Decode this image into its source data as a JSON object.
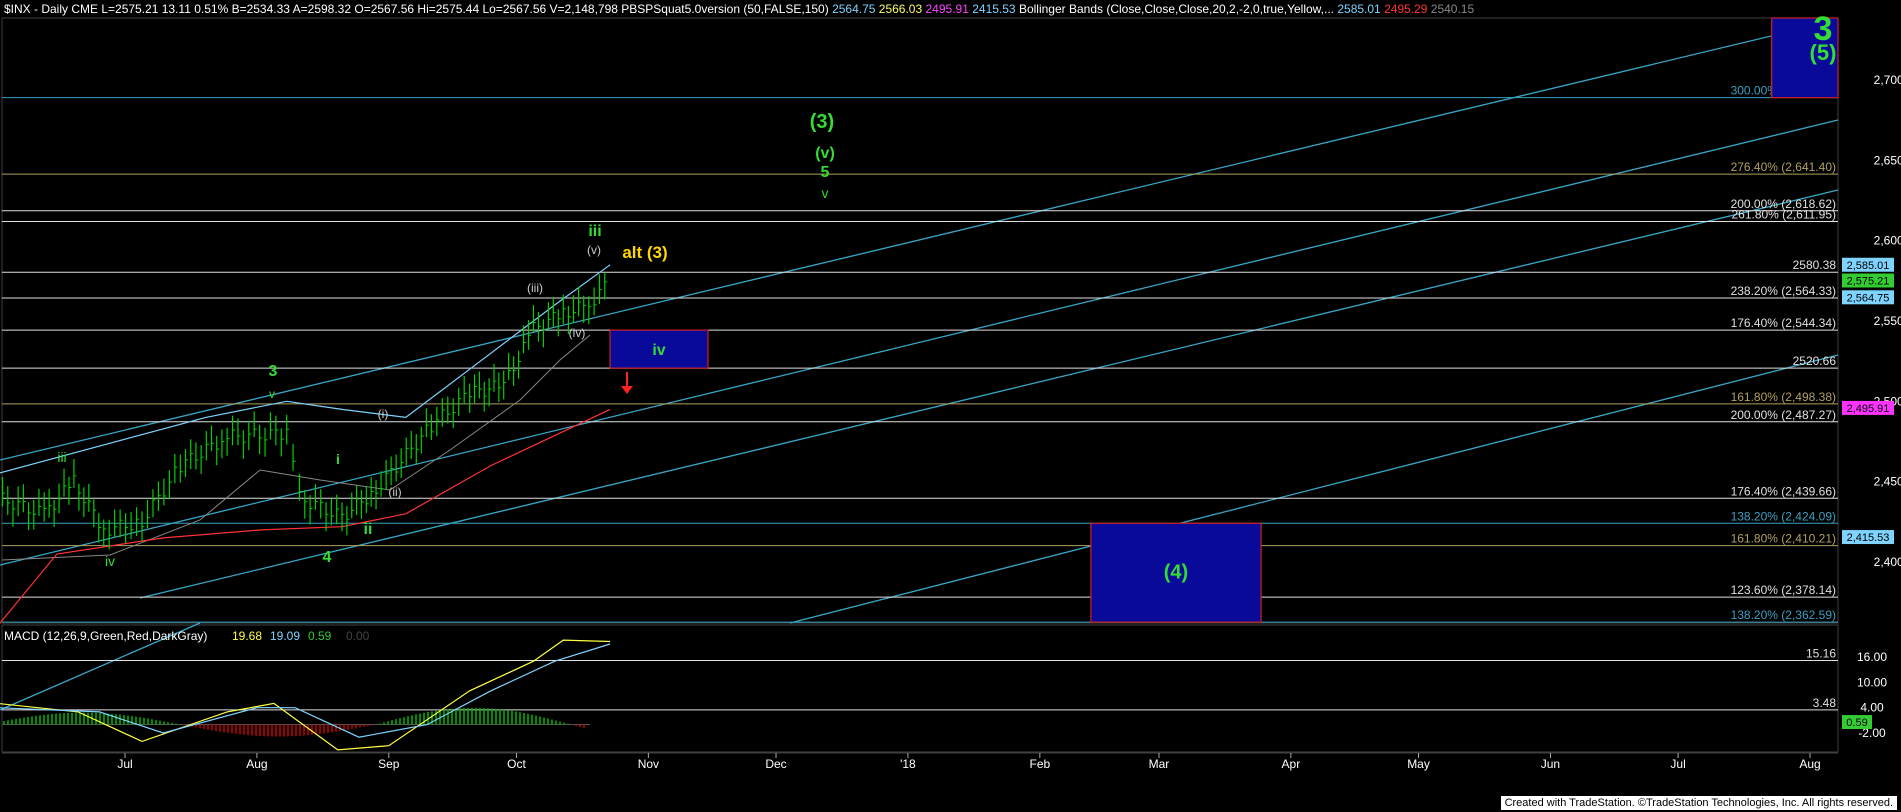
{
  "header": {
    "items": [
      {
        "text": "$INX - Daily  CME  L=2575.21  13.11  0.51%  B=2534.33  A=2598.32  O=2567.56  Hi=2575.44  Lo=2567.56  V=2,148,798",
        "color": "#ffffff"
      },
      {
        "text": "PBSPSquat5.0version (50,FALSE,150)",
        "color": "#ffffff"
      },
      {
        "text": "2564.75",
        "color": "#7fd3ff"
      },
      {
        "text": "2566.03",
        "color": "#ffff66"
      },
      {
        "text": "2495.91",
        "color": "#ff44ff"
      },
      {
        "text": "2415.53",
        "color": "#7fd3ff"
      },
      {
        "text": "Bollinger Bands (Close,Close,Close,20,2,-2,0,true,Yellow,...",
        "color": "#ffffff"
      },
      {
        "text": "2585.01",
        "color": "#7fd3ff"
      },
      {
        "text": "2495.29",
        "color": "#ff3333"
      },
      {
        "text": "2540.15",
        "color": "#888888"
      }
    ]
  },
  "chart_data": [
    {
      "type": "line",
      "title": "$INX - Daily",
      "series": [
        {
          "name": "Bars (approx. closes)",
          "color": "#00d000",
          "values": [
            {
              "x": "2017-06-01",
              "y": 2440
            },
            {
              "x": "2017-06-12",
              "y": 2430
            },
            {
              "x": "2017-06-19",
              "y": 2450
            },
            {
              "x": "2017-06-26",
              "y": 2420
            },
            {
              "x": "2017-07-05",
              "y": 2425
            },
            {
              "x": "2017-07-14",
              "y": 2460
            },
            {
              "x": "2017-07-25",
              "y": 2478
            },
            {
              "x": "2017-08-08",
              "y": 2480
            },
            {
              "x": "2017-08-11",
              "y": 2440
            },
            {
              "x": "2017-08-21",
              "y": 2428
            },
            {
              "x": "2017-08-29",
              "y": 2445
            },
            {
              "x": "2017-09-11",
              "y": 2485
            },
            {
              "x": "2017-09-20",
              "y": 2505
            },
            {
              "x": "2017-09-28",
              "y": 2510
            },
            {
              "x": "2017-10-05",
              "y": 2545
            },
            {
              "x": "2017-10-12",
              "y": 2555
            },
            {
              "x": "2017-10-18",
              "y": 2560
            },
            {
              "x": "2017-10-23",
              "y": 2575
            }
          ]
        },
        {
          "name": "Bollinger upper",
          "color": "#7fd3ff",
          "values": [
            {
              "x": "2017-06-01",
              "y": 2455
            },
            {
              "x": "2017-07-20",
              "y": 2490
            },
            {
              "x": "2017-08-08",
              "y": 2500
            },
            {
              "x": "2017-08-21",
              "y": 2495
            },
            {
              "x": "2017-09-05",
              "y": 2490
            },
            {
              "x": "2017-09-20",
              "y": 2520
            },
            {
              "x": "2017-10-10",
              "y": 2560
            },
            {
              "x": "2017-10-23",
              "y": 2585
            }
          ]
        },
        {
          "name": "Bollinger lower",
          "color": "#ff3333",
          "values": [
            {
              "x": "2017-06-01",
              "y": 2360
            },
            {
              "x": "2017-06-15",
              "y": 2405
            },
            {
              "x": "2017-07-10",
              "y": 2415
            },
            {
              "x": "2017-08-02",
              "y": 2420
            },
            {
              "x": "2017-08-21",
              "y": 2422
            },
            {
              "x": "2017-09-05",
              "y": 2430
            },
            {
              "x": "2017-09-25",
              "y": 2460
            },
            {
              "x": "2017-10-23",
              "y": 2495
            }
          ]
        }
      ],
      "y_axis_labels": [
        "2,700.00",
        "2,650.00",
        "2,600.00",
        "2,550.00",
        "2,500.00",
        "2,450.00",
        "2,400.00"
      ],
      "x_axis_labels": [
        "Jul",
        "Aug",
        "Sep",
        "Oct",
        "Nov",
        "Dec",
        "'18",
        "Feb",
        "Mar",
        "Apr",
        "May",
        "Jun",
        "Jul",
        "Aug"
      ],
      "horizontal_levels": [
        {
          "label": "300.00% (2,689.01)",
          "value": 2689.01,
          "color": "#3aa0c0"
        },
        {
          "label": "276.40% (2,641.40)",
          "value": 2641.4,
          "color": "#b0a060"
        },
        {
          "label": "200.00% (2,618.62)",
          "value": 2618.62,
          "color": "#e0e0e0"
        },
        {
          "label": "261.80% (2,611.95)",
          "value": 2611.95,
          "color": "#e0e0e0"
        },
        {
          "label": "2580.38",
          "value": 2580.38,
          "color": "#e0e0e0"
        },
        {
          "label": "238.20% (2,564.33)",
          "value": 2564.33,
          "color": "#e0e0e0"
        },
        {
          "label": "176.40% (2,544.34)",
          "value": 2544.34,
          "color": "#e0e0e0"
        },
        {
          "label": "2520.66",
          "value": 2520.66,
          "color": "#e0e0e0"
        },
        {
          "label": "161.80% (2,498.38)",
          "value": 2498.38,
          "color": "#b0a060"
        },
        {
          "label": "200.00% (2,487.27)",
          "value": 2487.27,
          "color": "#e0e0e0"
        },
        {
          "label": "176.40% (2,439.66)",
          "value": 2439.66,
          "color": "#e0e0e0"
        },
        {
          "label": "138.20% (2,424.09)",
          "value": 2424.09,
          "color": "#3aa0c0"
        },
        {
          "label": "161.80% (2,410.21)",
          "value": 2410.21,
          "color": "#b0a060"
        },
        {
          "label": "123.60% (2,378.14)",
          "value": 2378.14,
          "color": "#e0e0e0"
        },
        {
          "label": "138.20% (2,362.59)",
          "value": 2362.59,
          "color": "#3aa0c0"
        }
      ],
      "price_tags": [
        {
          "text": "2,585.01",
          "value": 2585.01,
          "bg": "#7fd3ff"
        },
        {
          "text": "2,575.21",
          "value": 2575.21,
          "bg": "#33cc33"
        },
        {
          "text": "2,564.75",
          "value": 2564.75,
          "bg": "#7fd3ff"
        },
        {
          "text": "2,495.91",
          "value": 2495.91,
          "bg": "#ff33ff"
        },
        {
          "text": "2,415.53",
          "value": 2415.53,
          "bg": "#7fd3ff"
        }
      ],
      "target_boxes": [
        {
          "label": "iv",
          "from": "2017-10-23",
          "to": "2017-11-15",
          "low": 2520.66,
          "high": 2544.34
        },
        {
          "label": "(4)",
          "from": "2018-02-13",
          "to": "2018-03-25",
          "low": 2362.59,
          "high": 2424.09
        },
        {
          "label": "3 (5)",
          "from": "2018-07-23",
          "to": "2018-08-18",
          "low": 2689.01,
          "high": 2745
        }
      ],
      "wave_labels": [
        {
          "text": "(3)",
          "color": "#33dd33"
        },
        {
          "text": "(v)",
          "color": "#33dd33"
        },
        {
          "text": "5",
          "color": "#33dd33"
        },
        {
          "text": "v",
          "color": "#33dd33"
        },
        {
          "text": "iii",
          "color": "#33dd33"
        },
        {
          "text": "(v)",
          "color": "#cccccc"
        },
        {
          "text": "alt (3)",
          "color": "#ffd700"
        },
        {
          "text": "(iii)",
          "color": "#cccccc"
        },
        {
          "text": "(iv)",
          "color": "#cccccc"
        },
        {
          "text": "3",
          "color": "#33dd33"
        },
        {
          "text": "v",
          "color": "#33dd33"
        },
        {
          "text": "iii",
          "color": "#33dd33"
        },
        {
          "text": "iv",
          "color": "#33dd33"
        },
        {
          "text": "4",
          "color": "#33dd33"
        },
        {
          "text": "ii",
          "color": "#33dd33"
        },
        {
          "text": "(i)",
          "color": "#cccccc"
        },
        {
          "text": "(ii)",
          "color": "#cccccc"
        },
        {
          "text": "i",
          "color": "#33dd33"
        }
      ]
    },
    {
      "type": "line",
      "title": "MACD (12,26,9,Green,Red,DarkGray)",
      "legend_values": [
        {
          "text": "19.68",
          "color": "#ffff44"
        },
        {
          "text": "19.09",
          "color": "#7fd3ff"
        },
        {
          "text": "0.59",
          "color": "#33cc33"
        },
        {
          "text": "0.00",
          "color": "#444444"
        }
      ],
      "y_axis_labels": [
        "16.00",
        "10.00",
        "4.00",
        "-2.00"
      ],
      "levels": [
        {
          "label": "15.16",
          "value": 15.16
        },
        {
          "label": "3.48",
          "value": 3.48
        }
      ],
      "price_tag": {
        "text": "0.59",
        "value": 0.59,
        "bg": "#33cc33"
      },
      "series": [
        {
          "name": "MACD",
          "color": "#ffff44",
          "values": [
            {
              "x": "2017-06-01",
              "y": 5
            },
            {
              "x": "2017-06-20",
              "y": 3
            },
            {
              "x": "2017-07-05",
              "y": -4
            },
            {
              "x": "2017-07-25",
              "y": 3
            },
            {
              "x": "2017-08-05",
              "y": 5
            },
            {
              "x": "2017-08-20",
              "y": -6
            },
            {
              "x": "2017-09-01",
              "y": -5
            },
            {
              "x": "2017-09-20",
              "y": 8
            },
            {
              "x": "2017-10-05",
              "y": 15
            },
            {
              "x": "2017-10-12",
              "y": 20
            },
            {
              "x": "2017-10-23",
              "y": 19.68
            }
          ]
        },
        {
          "name": "Signal",
          "color": "#7fd3ff",
          "values": [
            {
              "x": "2017-06-01",
              "y": 4
            },
            {
              "x": "2017-06-25",
              "y": 3
            },
            {
              "x": "2017-07-10",
              "y": -2
            },
            {
              "x": "2017-08-01",
              "y": 4
            },
            {
              "x": "2017-08-10",
              "y": 4
            },
            {
              "x": "2017-08-25",
              "y": -3
            },
            {
              "x": "2017-09-10",
              "y": 0
            },
            {
              "x": "2017-09-25",
              "y": 8
            },
            {
              "x": "2017-10-10",
              "y": 15
            },
            {
              "x": "2017-10-23",
              "y": 19.09
            }
          ]
        }
      ]
    }
  ],
  "footer": {
    "text": "Created with TradeStation. ©TradeStation Technologies, Inc. All rights reserved."
  }
}
